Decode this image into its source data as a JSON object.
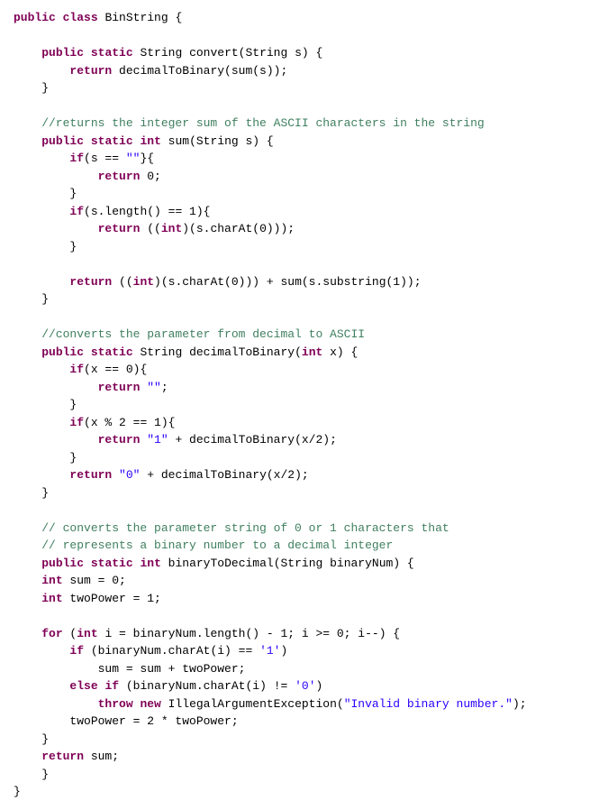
{
  "code": {
    "lines": [
      {
        "tokens": [
          {
            "t": "kw",
            "v": "public"
          },
          {
            "t": "plain",
            "v": " "
          },
          {
            "t": "kw",
            "v": "class"
          },
          {
            "t": "plain",
            "v": " BinString {"
          }
        ]
      },
      {
        "tokens": [
          {
            "t": "plain",
            "v": ""
          }
        ]
      },
      {
        "tokens": [
          {
            "t": "plain",
            "v": "    "
          },
          {
            "t": "kw",
            "v": "public"
          },
          {
            "t": "plain",
            "v": " "
          },
          {
            "t": "kw",
            "v": "static"
          },
          {
            "t": "plain",
            "v": " String convert(String s) {"
          }
        ]
      },
      {
        "tokens": [
          {
            "t": "plain",
            "v": "        "
          },
          {
            "t": "kw",
            "v": "return"
          },
          {
            "t": "plain",
            "v": " decimalToBinary(sum(s));"
          }
        ]
      },
      {
        "tokens": [
          {
            "t": "plain",
            "v": "    }"
          }
        ]
      },
      {
        "tokens": [
          {
            "t": "plain",
            "v": ""
          }
        ]
      },
      {
        "tokens": [
          {
            "t": "cm",
            "v": "    //returns the integer sum of the ASCII characters in the string"
          }
        ]
      },
      {
        "tokens": [
          {
            "t": "plain",
            "v": "    "
          },
          {
            "t": "kw",
            "v": "public"
          },
          {
            "t": "plain",
            "v": " "
          },
          {
            "t": "kw",
            "v": "static"
          },
          {
            "t": "plain",
            "v": " "
          },
          {
            "t": "kw",
            "v": "int"
          },
          {
            "t": "plain",
            "v": " sum(String s) {"
          }
        ]
      },
      {
        "tokens": [
          {
            "t": "plain",
            "v": "        "
          },
          {
            "t": "kw",
            "v": "if"
          },
          {
            "t": "plain",
            "v": "(s == "
          },
          {
            "t": "str",
            "v": "\"\""
          },
          {
            "t": "plain",
            "v": "}{"
          }
        ]
      },
      {
        "tokens": [
          {
            "t": "plain",
            "v": "            "
          },
          {
            "t": "kw",
            "v": "return"
          },
          {
            "t": "plain",
            "v": " 0;"
          }
        ]
      },
      {
        "tokens": [
          {
            "t": "plain",
            "v": "        }"
          }
        ]
      },
      {
        "tokens": [
          {
            "t": "plain",
            "v": "        "
          },
          {
            "t": "kw",
            "v": "if"
          },
          {
            "t": "plain",
            "v": "(s.length() == 1){"
          }
        ]
      },
      {
        "tokens": [
          {
            "t": "plain",
            "v": "            "
          },
          {
            "t": "kw",
            "v": "return"
          },
          {
            "t": "plain",
            "v": " (("
          },
          {
            "t": "kw",
            "v": "int"
          },
          {
            "t": "plain",
            "v": ")(s.charAt(0)));"
          }
        ]
      },
      {
        "tokens": [
          {
            "t": "plain",
            "v": "        }"
          }
        ]
      },
      {
        "tokens": [
          {
            "t": "plain",
            "v": ""
          }
        ]
      },
      {
        "tokens": [
          {
            "t": "plain",
            "v": "        "
          },
          {
            "t": "kw",
            "v": "return"
          },
          {
            "t": "plain",
            "v": " (("
          },
          {
            "t": "kw",
            "v": "int"
          },
          {
            "t": "plain",
            "v": ")(s.charAt(0))) + sum(s.substring(1));"
          }
        ]
      },
      {
        "tokens": [
          {
            "t": "plain",
            "v": "    }"
          }
        ]
      },
      {
        "tokens": [
          {
            "t": "plain",
            "v": ""
          }
        ]
      },
      {
        "tokens": [
          {
            "t": "cm",
            "v": "    //converts the parameter from decimal to ASCII"
          }
        ]
      },
      {
        "tokens": [
          {
            "t": "plain",
            "v": "    "
          },
          {
            "t": "kw",
            "v": "public"
          },
          {
            "t": "plain",
            "v": " "
          },
          {
            "t": "kw",
            "v": "static"
          },
          {
            "t": "plain",
            "v": " String decimalToBinary("
          },
          {
            "t": "kw",
            "v": "int"
          },
          {
            "t": "plain",
            "v": " x) {"
          }
        ]
      },
      {
        "tokens": [
          {
            "t": "plain",
            "v": "        "
          },
          {
            "t": "kw",
            "v": "if"
          },
          {
            "t": "plain",
            "v": "(x == 0){"
          }
        ]
      },
      {
        "tokens": [
          {
            "t": "plain",
            "v": "            "
          },
          {
            "t": "kw",
            "v": "return"
          },
          {
            "t": "plain",
            "v": " "
          },
          {
            "t": "str",
            "v": "\"\""
          },
          {
            "t": "plain",
            "v": ";"
          }
        ]
      },
      {
        "tokens": [
          {
            "t": "plain",
            "v": "        }"
          }
        ]
      },
      {
        "tokens": [
          {
            "t": "plain",
            "v": "        "
          },
          {
            "t": "kw",
            "v": "if"
          },
          {
            "t": "plain",
            "v": "(x % 2 == 1){"
          }
        ]
      },
      {
        "tokens": [
          {
            "t": "plain",
            "v": "            "
          },
          {
            "t": "kw",
            "v": "return"
          },
          {
            "t": "plain",
            "v": " "
          },
          {
            "t": "str",
            "v": "\"1\""
          },
          {
            "t": "plain",
            "v": " + decimalToBinary(x/2);"
          }
        ]
      },
      {
        "tokens": [
          {
            "t": "plain",
            "v": "        }"
          }
        ]
      },
      {
        "tokens": [
          {
            "t": "plain",
            "v": "        "
          },
          {
            "t": "kw",
            "v": "return"
          },
          {
            "t": "plain",
            "v": " "
          },
          {
            "t": "str",
            "v": "\"0\""
          },
          {
            "t": "plain",
            "v": " + decimalToBinary(x/2);"
          }
        ]
      },
      {
        "tokens": [
          {
            "t": "plain",
            "v": "    }"
          }
        ]
      },
      {
        "tokens": [
          {
            "t": "plain",
            "v": ""
          }
        ]
      },
      {
        "tokens": [
          {
            "t": "cm",
            "v": "    // converts the parameter string of 0 or 1 characters that"
          }
        ]
      },
      {
        "tokens": [
          {
            "t": "cm",
            "v": "    // represents a binary number to a decimal integer"
          }
        ]
      },
      {
        "tokens": [
          {
            "t": "plain",
            "v": "    "
          },
          {
            "t": "kw",
            "v": "public"
          },
          {
            "t": "plain",
            "v": " "
          },
          {
            "t": "kw",
            "v": "static"
          },
          {
            "t": "plain",
            "v": " "
          },
          {
            "t": "kw",
            "v": "int"
          },
          {
            "t": "plain",
            "v": " binaryToDecimal(String binaryNum) {"
          }
        ]
      },
      {
        "tokens": [
          {
            "t": "plain",
            "v": "    "
          },
          {
            "t": "kw",
            "v": "int"
          },
          {
            "t": "plain",
            "v": " sum = 0;"
          }
        ]
      },
      {
        "tokens": [
          {
            "t": "plain",
            "v": "    "
          },
          {
            "t": "kw",
            "v": "int"
          },
          {
            "t": "plain",
            "v": " twoPower = 1;"
          }
        ]
      },
      {
        "tokens": [
          {
            "t": "plain",
            "v": ""
          }
        ]
      },
      {
        "tokens": [
          {
            "t": "plain",
            "v": "    "
          },
          {
            "t": "kw",
            "v": "for"
          },
          {
            "t": "plain",
            "v": " ("
          },
          {
            "t": "kw",
            "v": "int"
          },
          {
            "t": "plain",
            "v": " i = binaryNum.length() - 1; i >= 0; i--) {"
          }
        ]
      },
      {
        "tokens": [
          {
            "t": "plain",
            "v": "        "
          },
          {
            "t": "kw",
            "v": "if"
          },
          {
            "t": "plain",
            "v": " (binaryNum.charAt(i) == "
          },
          {
            "t": "str",
            "v": "'1'"
          },
          {
            "t": "plain",
            "v": ")"
          }
        ]
      },
      {
        "tokens": [
          {
            "t": "plain",
            "v": "            sum = sum + twoPower;"
          }
        ]
      },
      {
        "tokens": [
          {
            "t": "plain",
            "v": "        "
          },
          {
            "t": "kw",
            "v": "else"
          },
          {
            "t": "plain",
            "v": " "
          },
          {
            "t": "kw",
            "v": "if"
          },
          {
            "t": "plain",
            "v": " (binaryNum.charAt(i) != "
          },
          {
            "t": "str",
            "v": "'0'"
          },
          {
            "t": "plain",
            "v": ")"
          }
        ]
      },
      {
        "tokens": [
          {
            "t": "plain",
            "v": "            "
          },
          {
            "t": "kw",
            "v": "throw"
          },
          {
            "t": "plain",
            "v": " "
          },
          {
            "t": "kw",
            "v": "new"
          },
          {
            "t": "plain",
            "v": " IllegalArgumentException("
          },
          {
            "t": "str",
            "v": "\"Invalid binary number.\""
          },
          {
            "t": "plain",
            "v": ");"
          }
        ]
      },
      {
        "tokens": [
          {
            "t": "plain",
            "v": "        twoPower = 2 * twoPower;"
          }
        ]
      },
      {
        "tokens": [
          {
            "t": "plain",
            "v": "    }"
          }
        ]
      },
      {
        "tokens": [
          {
            "t": "plain",
            "v": "    "
          },
          {
            "t": "kw",
            "v": "return"
          },
          {
            "t": "plain",
            "v": " sum;"
          }
        ]
      },
      {
        "tokens": [
          {
            "t": "plain",
            "v": "    }"
          }
        ]
      },
      {
        "tokens": [
          {
            "t": "plain",
            "v": "}"
          }
        ]
      }
    ]
  }
}
